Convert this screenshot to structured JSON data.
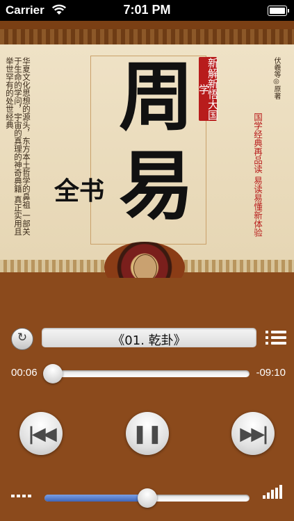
{
  "status_bar": {
    "carrier": "Carrier",
    "time": "7:01 PM",
    "wifi_icon": "wifi-icon",
    "battery_icon": "battery-icon"
  },
  "cover": {
    "title": "周易",
    "subtitle_red": "新解新悟大国学",
    "quan_shu": "全书",
    "left_text": "华夏文化思想的源头，东方本土哲学的鼻祖 一部关于生命的学问，宇宙的真理的神奇典籍 真正实用且举世罕有的处世经典",
    "author": "伏羲等◎原著",
    "right_text": "国学经典再品读 易读易懂新体验"
  },
  "player": {
    "track_title": "《01. 乾卦》",
    "elapsed": "00:06",
    "remaining": "-09:10",
    "progress_fraction": 0.02,
    "volume_fraction": 0.5,
    "repeat_icon": "repeat-icon",
    "list_icon": "playlist-icon",
    "prev_icon": "previous-track-icon",
    "pause_icon": "pause-icon",
    "next_icon": "next-track-icon"
  }
}
